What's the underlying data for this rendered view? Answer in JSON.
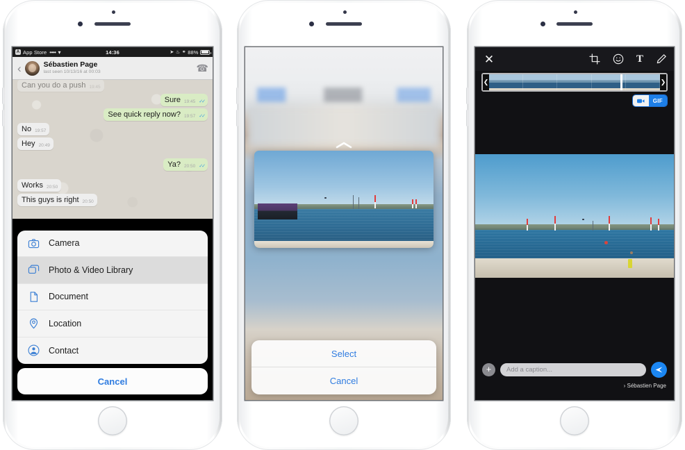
{
  "phone1": {
    "label": "whatsapp-chat-with-attachment-sheet",
    "status_bar": {
      "app_badge": "A",
      "app_name": "App Store",
      "signal": "••••",
      "wifi_icon": "wifi-icon",
      "time": "14:36",
      "location_icon": "location-arrow-icon",
      "alarm_icon": "shield-icon",
      "bluetooth_icon": "bluetooth-icon",
      "battery_text": "88%"
    },
    "nav": {
      "back_icon": "chevron-left-icon",
      "avatar": "contact-avatar",
      "contact_name": "Sébastien Page",
      "last_seen": "last seen 10/13/16 at 00:03",
      "call_icon": "phone-icon"
    },
    "messages": [
      {
        "text": "Can you do a push",
        "time": "19:45",
        "side": "in",
        "cut": true,
        "ticks": false
      },
      {
        "text": "Sure",
        "time": "19:45",
        "side": "out",
        "cut": false,
        "ticks": true
      },
      {
        "text": "See quick reply now?",
        "time": "19:57",
        "side": "out",
        "cut": false,
        "ticks": true
      },
      {
        "text": "No",
        "time": "19:57",
        "side": "in",
        "cut": false,
        "ticks": false
      },
      {
        "text": "Hey",
        "time": "20:49",
        "side": "in",
        "cut": false,
        "ticks": false
      },
      {
        "text": "Ya?",
        "time": "20:50",
        "side": "out",
        "cut": false,
        "ticks": true
      },
      {
        "text": "Works",
        "time": "20:50",
        "side": "in",
        "cut": false,
        "ticks": false
      },
      {
        "text": "This guys is right",
        "time": "20:50",
        "side": "in",
        "cut": false,
        "ticks": false
      }
    ],
    "action_sheet": {
      "items": [
        {
          "label": "Camera",
          "icon": "camera-icon",
          "highlighted": false
        },
        {
          "label": "Photo & Video Library",
          "icon": "photos-icon",
          "highlighted": true
        },
        {
          "label": "Document",
          "icon": "document-icon",
          "highlighted": false
        },
        {
          "label": "Location",
          "icon": "location-pin-icon",
          "highlighted": false
        },
        {
          "label": "Contact",
          "icon": "contact-icon",
          "highlighted": false
        }
      ],
      "cancel_label": "Cancel"
    }
  },
  "phone2": {
    "label": "photo-preview-with-select-sheet",
    "chevron_icon": "chevron-up-icon",
    "photo_alt": "seascape-with-barge-and-sailboats",
    "actions": [
      {
        "label": "Select"
      },
      {
        "label": "Cancel"
      }
    ]
  },
  "phone3": {
    "label": "media-editor-with-caption",
    "toolbar": {
      "close_icon": "close-x-icon",
      "crop_icon": "crop-icon",
      "sticker_icon": "emoji-smiley-icon",
      "text_icon": "text-tool-icon",
      "text_label": "T",
      "draw_icon": "pencil-icon"
    },
    "scrubber": {
      "left_handle_icon": "chevron-left-handle-icon",
      "right_handle_icon": "chevron-right-handle-icon",
      "playhead_percent": 77,
      "frame_count": 5
    },
    "mode_toggle": {
      "video_icon": "video-camera-icon",
      "gif_label": "GIF",
      "selected": "video"
    },
    "photo_alt": "harbor-with-air-race-pylons-and-pier",
    "caption": {
      "add_icon": "plus-icon",
      "placeholder": "Add a caption...",
      "send_icon": "send-paper-plane-icon"
    },
    "recipient_chevron": "›",
    "recipient_name": "Sébastien Page"
  },
  "colors": {
    "ios_blue": "#2f7ce0",
    "whatsapp_out_bubble": "#d9ecc4",
    "whatsapp_in_bubble": "#eeeeee",
    "read_tick_blue": "#3aa0e0",
    "editor_black": "#111114",
    "send_blue": "#1b86f2"
  }
}
